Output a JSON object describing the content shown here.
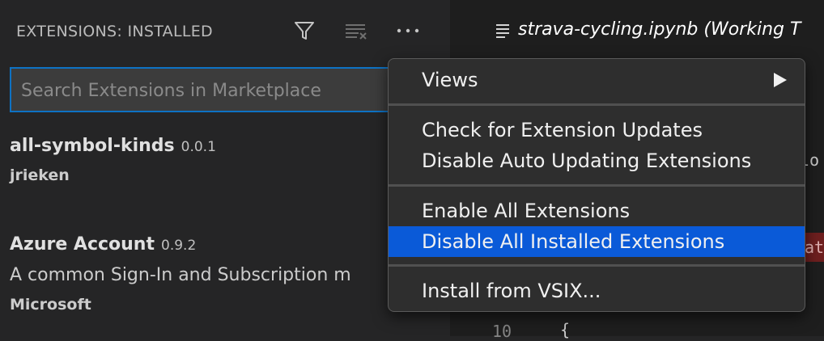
{
  "sidebar": {
    "title": "EXTENSIONS: INSTALLED",
    "icons": [
      "filter-icon",
      "clear-extensions-icon",
      "more-actions-icon"
    ],
    "search": {
      "placeholder": "Search Extensions in Marketplace",
      "value": ""
    },
    "extensions": [
      {
        "name": "all-symbol-kinds",
        "version": "0.0.1",
        "description": "",
        "publisher": "jrieken"
      },
      {
        "name": "Azure Account",
        "version": "0.9.2",
        "description": "A common Sign-In and Subscription m",
        "publisher": "Microsoft"
      }
    ]
  },
  "editor": {
    "tab_label": "strava-cycling.ipynb (Working T",
    "code_fragment_1": "lo",
    "code_fragment_2": "at",
    "line_number": "10",
    "code_fragment_3": "{"
  },
  "context_menu": {
    "items": [
      {
        "label": "Views",
        "has_submenu": true
      },
      {
        "label": "Check for Extension Updates"
      },
      {
        "label": "Disable Auto Updating Extensions"
      },
      {
        "label": "Enable All Extensions"
      },
      {
        "label": "Disable All Installed Extensions",
        "highlighted": true
      },
      {
        "label": "Install from VSIX..."
      }
    ]
  },
  "colors": {
    "sidebar_bg": "#252526",
    "editor_bg": "#1e1e1e",
    "focus_border": "#0e72c4",
    "menu_highlight": "#0a5ad8"
  }
}
